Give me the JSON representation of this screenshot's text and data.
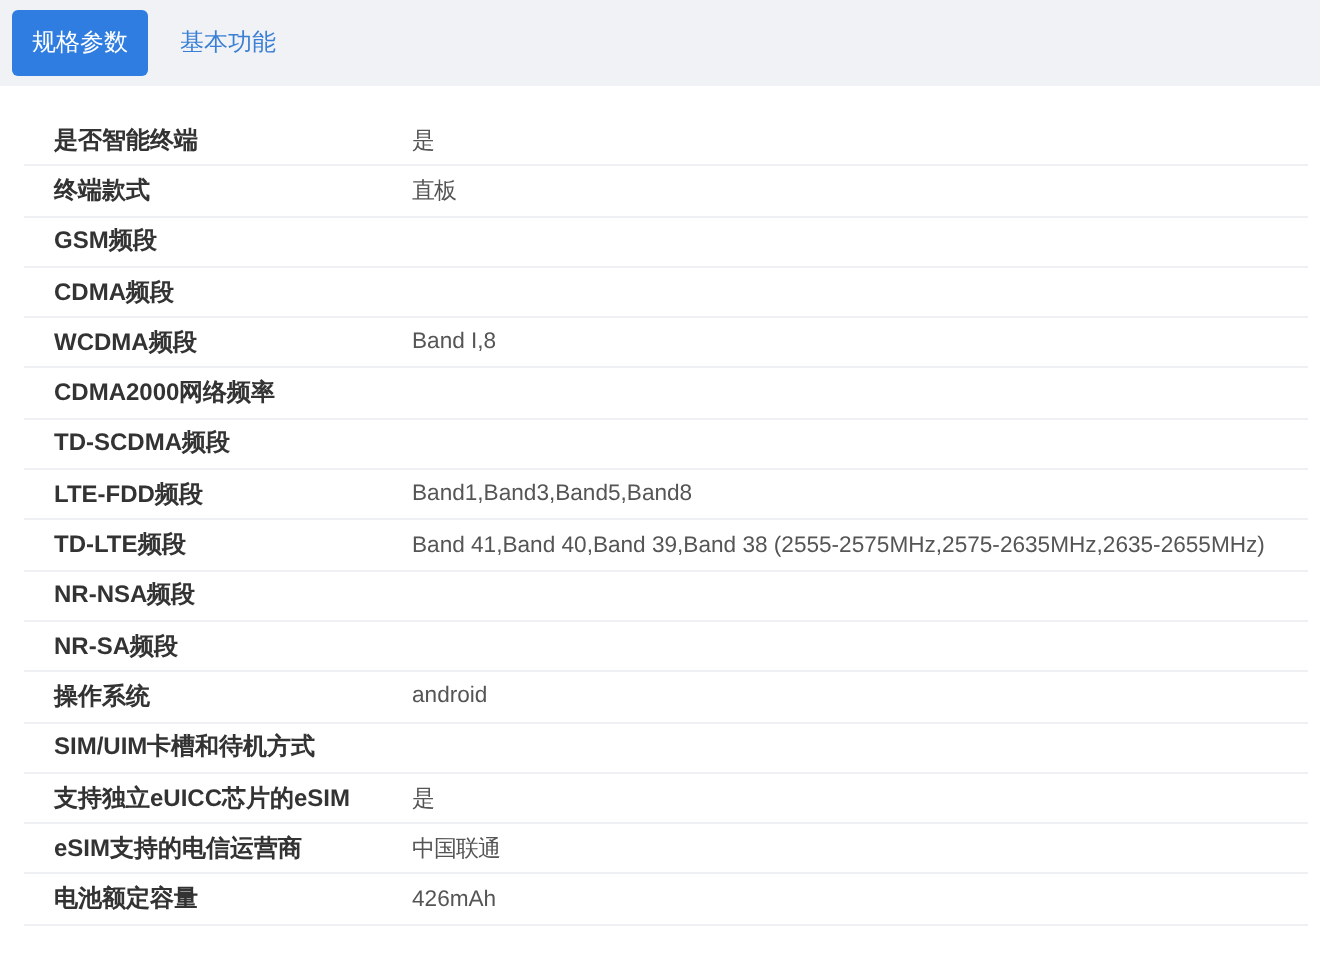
{
  "tabs": [
    {
      "label": "规格参数",
      "selected": true
    },
    {
      "label": "基本功能",
      "selected": false
    }
  ],
  "specs": [
    {
      "name": "是否智能终端",
      "value": "是"
    },
    {
      "name": "终端款式",
      "value": "直板"
    },
    {
      "name": "GSM频段"
    },
    {
      "name": "CDMA频段"
    },
    {
      "name": "WCDMA频段",
      "value": "Band I,8"
    },
    {
      "name": "CDMA2000网络频率"
    },
    {
      "name": "TD-SCDMA频段"
    },
    {
      "name": "LTE-FDD频段",
      "value": "Band1,Band3,Band5,Band8"
    },
    {
      "name": "TD-LTE频段",
      "value": "Band 41,Band 40,Band 39,Band 38 (2555-2575MHz,2575-2635MHz,2635-2655MHz)"
    },
    {
      "name": "NR-NSA频段"
    },
    {
      "name": "NR-SA频段"
    },
    {
      "name": "操作系统",
      "value": "android"
    },
    {
      "name": "SIM/UIM卡槽和待机方式"
    },
    {
      "name": "支持独立eUICC芯片的eSIM",
      "value": "是"
    },
    {
      "name": "eSIM支持的电信运营商",
      "value": "中国联通"
    },
    {
      "name": "电池额定容量",
      "value": "426mAh"
    }
  ]
}
